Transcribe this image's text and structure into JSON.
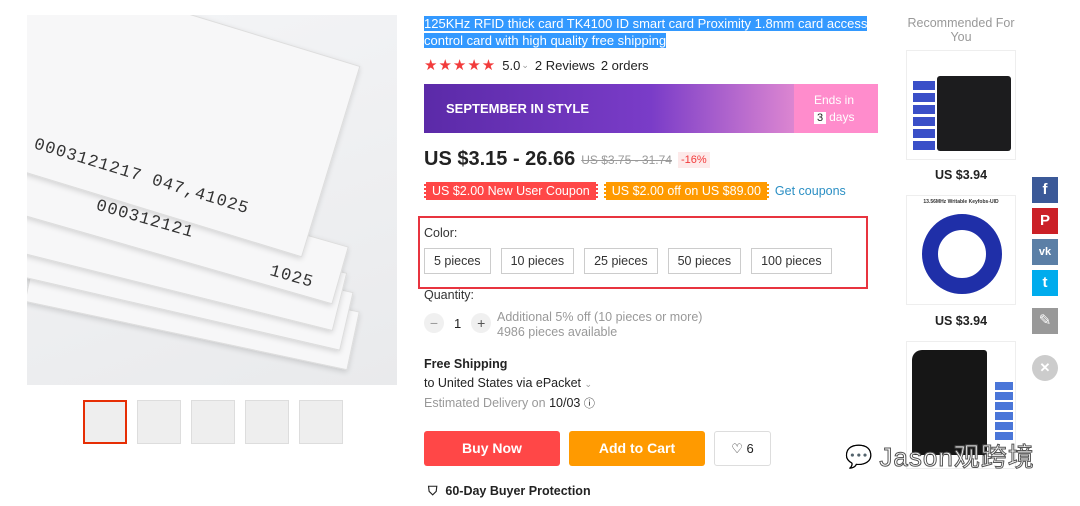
{
  "gallery": {
    "card_numbers": [
      "0003121217 047,41025",
      "000312121",
      "1025",
      "000312121",
      "000312121",
      "000312121"
    ],
    "thumb_count": 5
  },
  "product": {
    "title": "125KHz RFID thick card TK4100 ID smart card Proximity 1.8mm card access control card with high quality free shipping",
    "rating": "5.0",
    "reviews": "2 Reviews",
    "orders": "2 orders",
    "banner": {
      "title": "SEPTEMBER IN STYLE",
      "ends_in": "Ends in",
      "days_num": "3",
      "days": "days"
    },
    "price": "US $3.15 - 26.66",
    "old_price": "US $3.75 - 31.74",
    "discount": "-16%",
    "coupons": [
      "US $2.00 New User Coupon",
      "US $2.00 off on US $89.00"
    ],
    "get_coupons": "Get coupons",
    "color_label": "Color:",
    "options": [
      "5 pieces",
      "10 pieces",
      "25 pieces",
      "50 pieces",
      "100 pieces"
    ],
    "quantity_label": "Quantity:",
    "quantity": "1",
    "qty_note": "Additional 5% off (10 pieces or more)",
    "available": "4986 pieces available",
    "shipping": "Free Shipping",
    "ship_to": "to United States via ePacket",
    "delivery_label": "Estimated Delivery on",
    "delivery_date": "10/03",
    "buy_now": "Buy Now",
    "add_to_cart": "Add to Cart",
    "wishlist_count": "6",
    "protection": "60-Day Buyer Protection"
  },
  "recommended": {
    "title": "Recommended For You",
    "items": [
      {
        "price": "US $3.94",
        "label": ""
      },
      {
        "price": "US $3.94",
        "label": "13.56MHz Writable Keyfobs-UID"
      },
      {
        "price": "",
        "label": ""
      }
    ]
  },
  "social": [
    "f",
    "P",
    "vk",
    "t",
    "✎",
    "✕"
  ],
  "watermark": "Jason观跨境",
  "colors": {
    "buy": "#ff4747",
    "cart": "#ff9a00",
    "star": "#f23b3b",
    "facebook": "#3b5998",
    "pinterest": "#cb2027",
    "vk": "#5b7fa6",
    "twitter": "#00aced"
  }
}
